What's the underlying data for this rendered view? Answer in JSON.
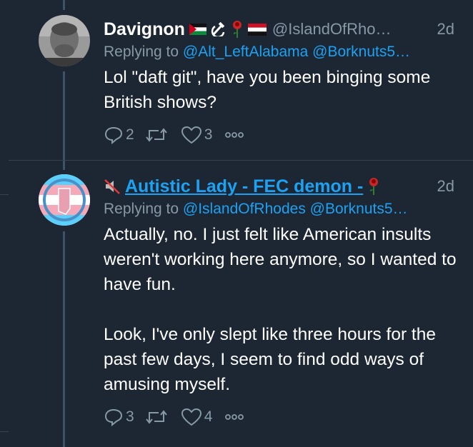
{
  "tweets": [
    {
      "display_name": "Davignon",
      "handle": "@IslandOfRho…",
      "time": "2d",
      "replying_to_label": "Replying to",
      "mentions": [
        "@Alt_LeftAlabama",
        "@Borknuts5…"
      ],
      "body": [
        "Lol \"daft git\", have you been binging some British shows?"
      ],
      "reply_count": "2",
      "retweet_count": "",
      "like_count": "3",
      "name_emojis": [
        "palestine-flag-icon",
        "hammer-sickle-icon",
        "rose-icon",
        "yemen-flag-icon"
      ]
    },
    {
      "display_name": "Autistic Lady - FEC demon -",
      "handle": "",
      "time": "2d",
      "replying_to_label": "Replying to",
      "mentions": [
        "@IslandOfRhodes",
        "@Borknuts5…"
      ],
      "body": [
        "Actually, no. I just felt like American insults weren't working here anymore, so I wanted to have fun.",
        "Look, I've only slept like three hours for the past few days, I seem to find odd ways of amusing myself."
      ],
      "reply_count": "3",
      "retweet_count": "",
      "like_count": "4",
      "name_emojis": [
        "muted-speaker-icon",
        "rose-icon"
      ]
    }
  ],
  "colors": {
    "background": "#1c2733",
    "text": "#ffffff",
    "muted": "#8899a6",
    "link": "#1da1f2",
    "thread_line": "#3d5466"
  }
}
